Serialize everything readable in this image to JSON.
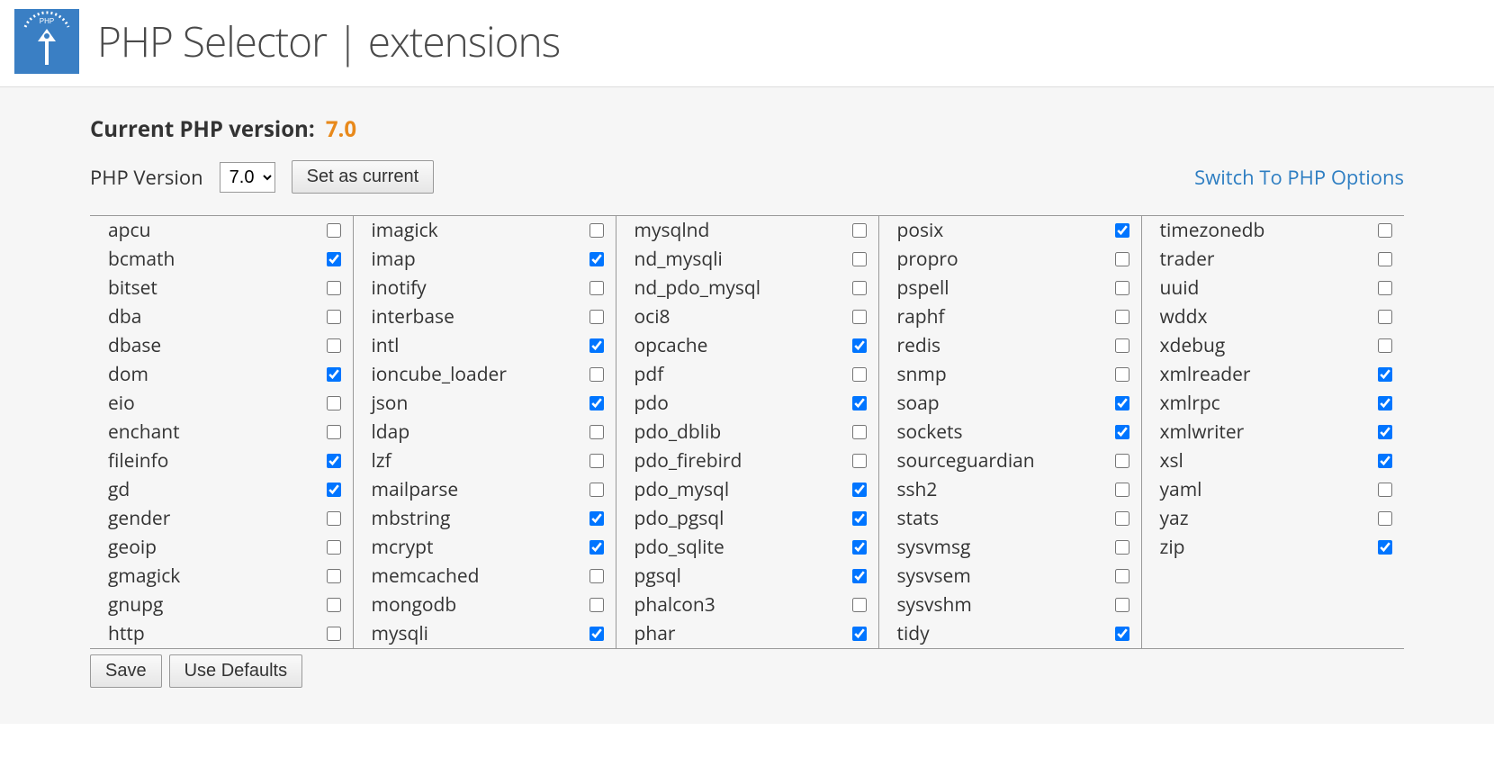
{
  "header": {
    "title": "PHP Selector | extensions"
  },
  "version": {
    "label": "Current PHP version:",
    "current": "7.0",
    "select_label": "PHP Version",
    "select_value": "7.0",
    "set_button": "Set as current",
    "switch_link": "Switch To PHP Options"
  },
  "extensions": {
    "columns": [
      [
        {
          "name": "apcu",
          "checked": false
        },
        {
          "name": "bcmath",
          "checked": true
        },
        {
          "name": "bitset",
          "checked": false
        },
        {
          "name": "dba",
          "checked": false
        },
        {
          "name": "dbase",
          "checked": false
        },
        {
          "name": "dom",
          "checked": true
        },
        {
          "name": "eio",
          "checked": false
        },
        {
          "name": "enchant",
          "checked": false
        },
        {
          "name": "fileinfo",
          "checked": true
        },
        {
          "name": "gd",
          "checked": true
        },
        {
          "name": "gender",
          "checked": false
        },
        {
          "name": "geoip",
          "checked": false
        },
        {
          "name": "gmagick",
          "checked": false
        },
        {
          "name": "gnupg",
          "checked": false
        },
        {
          "name": "http",
          "checked": false
        }
      ],
      [
        {
          "name": "imagick",
          "checked": false
        },
        {
          "name": "imap",
          "checked": true
        },
        {
          "name": "inotify",
          "checked": false
        },
        {
          "name": "interbase",
          "checked": false
        },
        {
          "name": "intl",
          "checked": true
        },
        {
          "name": "ioncube_loader",
          "checked": false
        },
        {
          "name": "json",
          "checked": true
        },
        {
          "name": "ldap",
          "checked": false
        },
        {
          "name": "lzf",
          "checked": false
        },
        {
          "name": "mailparse",
          "checked": false
        },
        {
          "name": "mbstring",
          "checked": true
        },
        {
          "name": "mcrypt",
          "checked": true
        },
        {
          "name": "memcached",
          "checked": false
        },
        {
          "name": "mongodb",
          "checked": false
        },
        {
          "name": "mysqli",
          "checked": true
        }
      ],
      [
        {
          "name": "mysqlnd",
          "checked": false
        },
        {
          "name": "nd_mysqli",
          "checked": false
        },
        {
          "name": "nd_pdo_mysql",
          "checked": false
        },
        {
          "name": "oci8",
          "checked": false
        },
        {
          "name": "opcache",
          "checked": true
        },
        {
          "name": "pdf",
          "checked": false
        },
        {
          "name": "pdo",
          "checked": true
        },
        {
          "name": "pdo_dblib",
          "checked": false
        },
        {
          "name": "pdo_firebird",
          "checked": false
        },
        {
          "name": "pdo_mysql",
          "checked": true
        },
        {
          "name": "pdo_pgsql",
          "checked": true
        },
        {
          "name": "pdo_sqlite",
          "checked": true
        },
        {
          "name": "pgsql",
          "checked": true
        },
        {
          "name": "phalcon3",
          "checked": false
        },
        {
          "name": "phar",
          "checked": true
        }
      ],
      [
        {
          "name": "posix",
          "checked": true
        },
        {
          "name": "propro",
          "checked": false
        },
        {
          "name": "pspell",
          "checked": false
        },
        {
          "name": "raphf",
          "checked": false
        },
        {
          "name": "redis",
          "checked": false
        },
        {
          "name": "snmp",
          "checked": false
        },
        {
          "name": "soap",
          "checked": true
        },
        {
          "name": "sockets",
          "checked": true
        },
        {
          "name": "sourceguardian",
          "checked": false
        },
        {
          "name": "ssh2",
          "checked": false
        },
        {
          "name": "stats",
          "checked": false
        },
        {
          "name": "sysvmsg",
          "checked": false
        },
        {
          "name": "sysvsem",
          "checked": false
        },
        {
          "name": "sysvshm",
          "checked": false
        },
        {
          "name": "tidy",
          "checked": true
        }
      ],
      [
        {
          "name": "timezonedb",
          "checked": false
        },
        {
          "name": "trader",
          "checked": false
        },
        {
          "name": "uuid",
          "checked": false
        },
        {
          "name": "wddx",
          "checked": false
        },
        {
          "name": "xdebug",
          "checked": false
        },
        {
          "name": "xmlreader",
          "checked": true
        },
        {
          "name": "xmlrpc",
          "checked": true
        },
        {
          "name": "xmlwriter",
          "checked": true
        },
        {
          "name": "xsl",
          "checked": true
        },
        {
          "name": "yaml",
          "checked": false
        },
        {
          "name": "yaz",
          "checked": false
        },
        {
          "name": "zip",
          "checked": true
        }
      ]
    ]
  },
  "buttons": {
    "save": "Save",
    "defaults": "Use Defaults"
  }
}
